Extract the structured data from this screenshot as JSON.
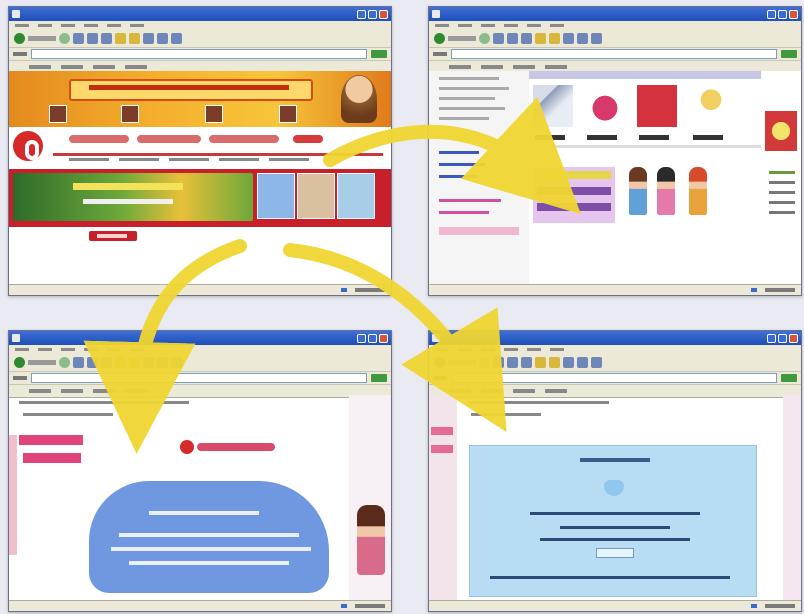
{
  "colors": {
    "arrow": "#f0d632",
    "titlebar": "#2b5cc6",
    "chrome": "#ece9d8",
    "site_red": "#c8202a",
    "site_pink": "#e0447a",
    "panel_blue": "#b8dcf4"
  },
  "icons": [
    "back-icon",
    "forward-icon",
    "stop-icon",
    "refresh-icon",
    "home-icon",
    "search-icon",
    "favorites-icon",
    "history-icon",
    "mail-icon",
    "print-icon"
  ],
  "windows": [
    {
      "id": "top-left",
      "page": "site-home"
    },
    {
      "id": "top-right",
      "page": "shop-page"
    },
    {
      "id": "bottom-left",
      "page": "signup-page"
    },
    {
      "id": "bottom-right",
      "page": "confirmation-page"
    }
  ]
}
